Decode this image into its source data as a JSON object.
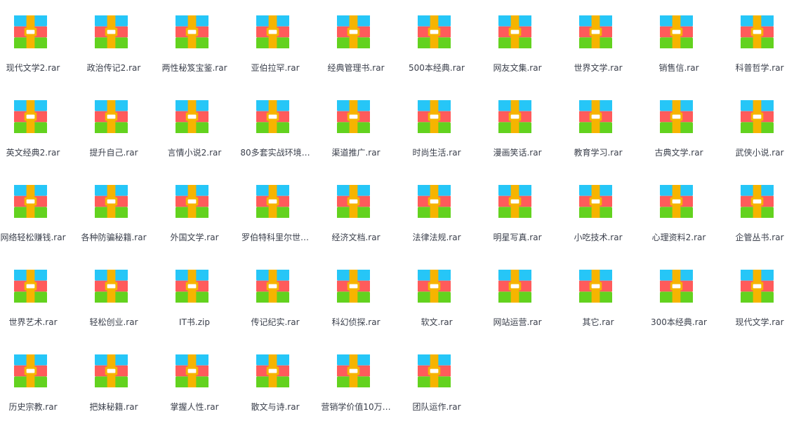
{
  "colors": {
    "archive_top": "#26c6f7",
    "archive_middle": "#ff5b5b",
    "archive_bottom": "#63d21f",
    "archive_strap": "#f6b400",
    "archive_clasp": "#ffffff",
    "label_text": "#3a3f4b"
  },
  "icon": "archive-icon",
  "files": [
    {
      "name": "现代文学2.rar"
    },
    {
      "name": "政治传记2.rar"
    },
    {
      "name": "两性秘笈宝鉴.rar"
    },
    {
      "name": "亚伯拉罕.rar"
    },
    {
      "name": "经典管理书.rar"
    },
    {
      "name": "500本经典.rar"
    },
    {
      "name": "网友文集.rar"
    },
    {
      "name": "世界文学.rar"
    },
    {
      "name": "销售信.rar"
    },
    {
      "name": "科普哲学.rar"
    },
    {
      "name": "英文经典2.rar"
    },
    {
      "name": "提升自己.rar"
    },
    {
      "name": "言情小说2.rar"
    },
    {
      "name": "80多套实战环境…"
    },
    {
      "name": "渠道推广.rar"
    },
    {
      "name": "时尚生活.rar"
    },
    {
      "name": "漫画笑话.rar"
    },
    {
      "name": "教育学习.rar"
    },
    {
      "name": "古典文学.rar"
    },
    {
      "name": "武侠小说.rar"
    },
    {
      "name": "网络轻松赚钱.rar"
    },
    {
      "name": "各种防骗秘籍.rar"
    },
    {
      "name": "外国文学.rar"
    },
    {
      "name": "罗伯特科里尔世…"
    },
    {
      "name": "经济文档.rar"
    },
    {
      "name": "法律法规.rar"
    },
    {
      "name": "明星写真.rar"
    },
    {
      "name": "小吃技术.rar"
    },
    {
      "name": "心理资料2.rar"
    },
    {
      "name": "企管丛书.rar"
    },
    {
      "name": "世界艺术.rar"
    },
    {
      "name": "轻松创业.rar"
    },
    {
      "name": "IT书.zip"
    },
    {
      "name": "传记纪实.rar"
    },
    {
      "name": "科幻侦探.rar"
    },
    {
      "name": "软文.rar"
    },
    {
      "name": "网站运营.rar"
    },
    {
      "name": "其它.rar"
    },
    {
      "name": "300本经典.rar"
    },
    {
      "name": "现代文学.rar"
    },
    {
      "name": "历史宗教.rar"
    },
    {
      "name": "把妹秘籍.rar"
    },
    {
      "name": "掌握人性.rar"
    },
    {
      "name": "散文与诗.rar"
    },
    {
      "name": "营销学价值10万…"
    },
    {
      "name": "团队运作.rar"
    }
  ]
}
